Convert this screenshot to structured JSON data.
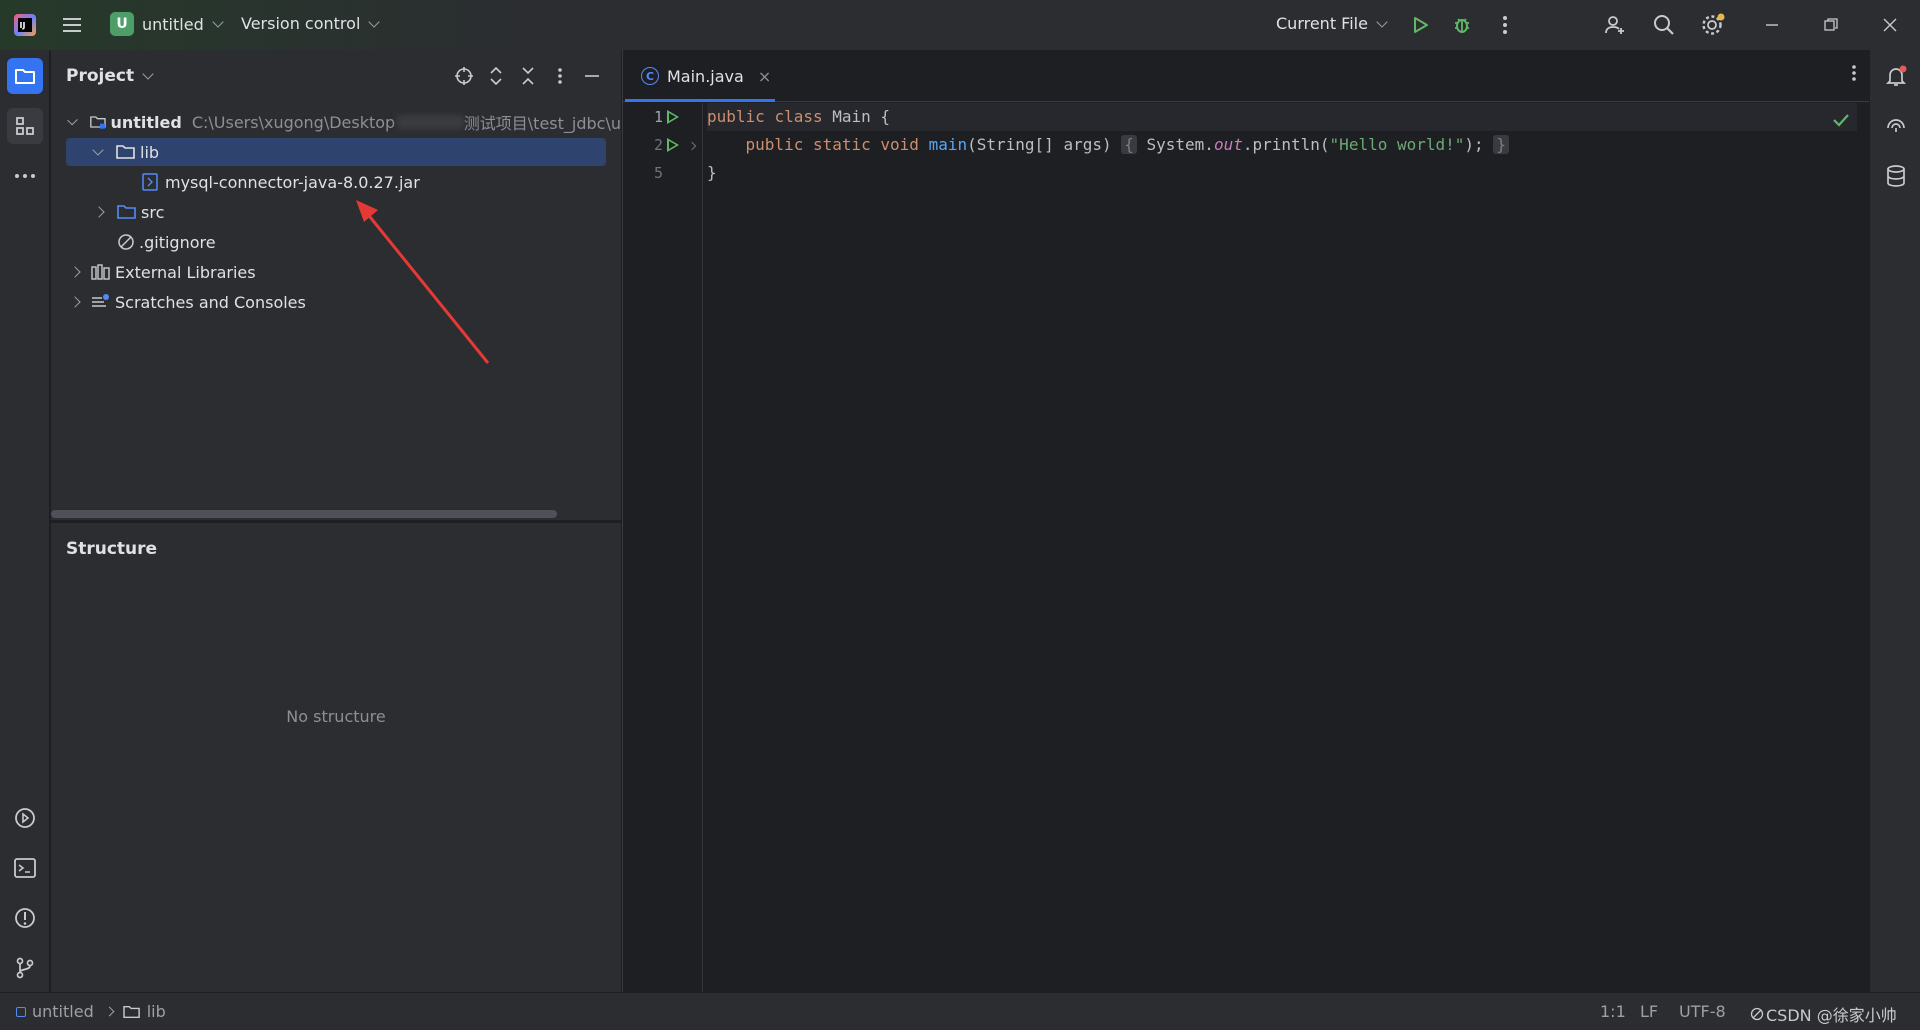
{
  "titlebar": {
    "project_badge": "U",
    "project_name": "untitled",
    "vcs_label": "Version control",
    "run_config": "Current File",
    "icons": [
      "app-logo-icon",
      "main-menu-icon",
      "run-icon",
      "debug-icon",
      "more-icon",
      "add-user-icon",
      "search-icon",
      "settings-icon",
      "minimize-icon",
      "restore-icon",
      "close-icon"
    ],
    "run_color": "#5fb865",
    "debug_color": "#5fb865"
  },
  "left_strip": {
    "icons": [
      "project-folder-icon",
      "structure-icon",
      "more-tools-icon",
      "run-tool-icon",
      "terminal-icon",
      "problems-icon",
      "git-icon"
    ],
    "active_color": "#3574f0"
  },
  "project_panel": {
    "title": "Project",
    "tree": [
      {
        "label": "untitled",
        "path": "C:\\Users\\xugong\\Desktop",
        "path_tail": "测试项目\\test_jdbc\\u"
      },
      {
        "label": "lib"
      },
      {
        "label": "mysql-connector-java-8.0.27.jar"
      },
      {
        "label": "src"
      },
      {
        "label": ".gitignore"
      },
      {
        "label": "External Libraries"
      },
      {
        "label": "Scratches and Consoles"
      }
    ],
    "selected_color": "#2e436e"
  },
  "structure_panel": {
    "title": "Structure",
    "empty_text": "No structure"
  },
  "editor": {
    "tab_label": "Main.java",
    "tab_icon_letter": "C",
    "close_glyph": "×",
    "line_numbers": [
      "1",
      "2",
      "5"
    ],
    "code": {
      "l1_kw1": "public",
      "l1_kw2": "class",
      "l1_name": " Main {",
      "l2_kw1": "public",
      "l2_kw2": "static",
      "l2_kw3": "void",
      "l2_fn": "main",
      "l2_args": "(String[] args) ",
      "l2_lbrace": "{",
      "l2_sys": " System.",
      "l2_out": "out",
      "l2_println": ".println(",
      "l2_str": "\"Hello world!\"",
      "l2_end": "); ",
      "l2_rbrace": "}",
      "l3": "}"
    },
    "keyword_color": "#cf8e6d",
    "function_color": "#56a8f5",
    "string_color": "#6aab73"
  },
  "right_strip": {
    "icons": [
      "notifications-icon",
      "ai-assistant-icon",
      "database-icon"
    ]
  },
  "statusbar": {
    "crumb_project": "untitled",
    "crumb_folder": "lib",
    "position": "1:1",
    "line_sep": "LF",
    "encoding": "UTF-8",
    "watermark": "CSDN @徐家小帅"
  }
}
